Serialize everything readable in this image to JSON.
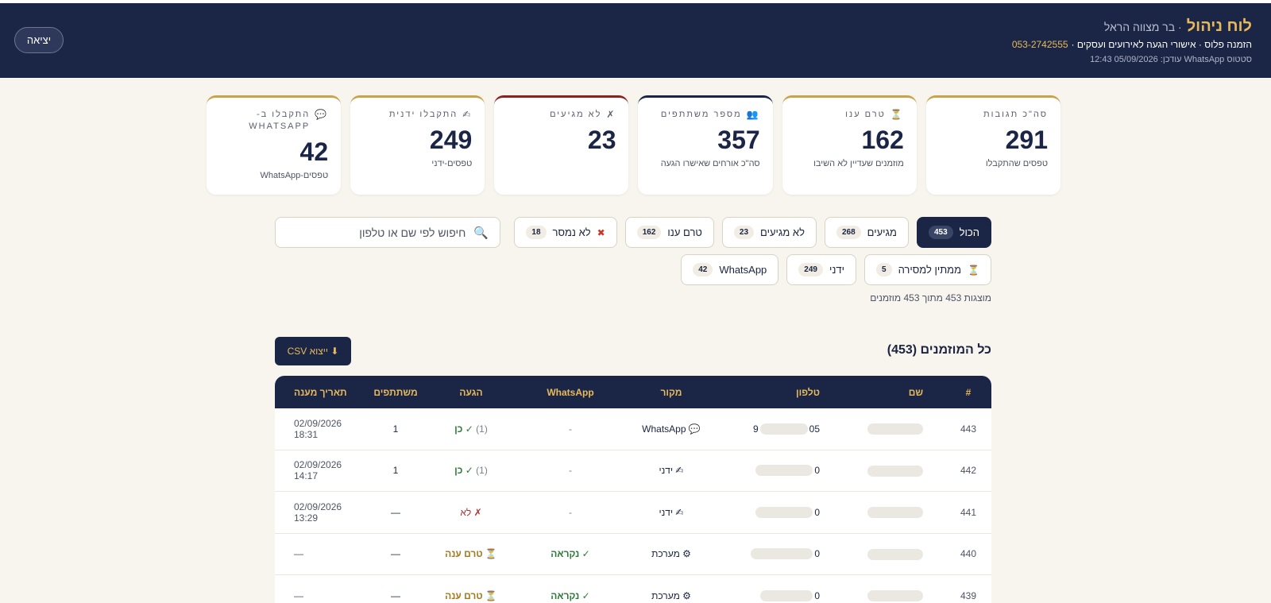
{
  "header": {
    "title": "לוח ניהול",
    "subtitle": "· בר מצווה הראל",
    "line2_text": "הזמנה פלוס · אישורי הגעה לאירועים ועסקים ·",
    "phone": "053-2742555",
    "status": "סטטוס WhatsApp עודכן: 05/09/2026 12:43",
    "logout_label": "יציאה"
  },
  "stats": [
    {
      "label": "סה\"כ תגובות",
      "icon": "",
      "value": "291",
      "desc": "טפסים שהתקבלו"
    },
    {
      "label": "טרם ענו",
      "icon": "hourglass-icon",
      "value": "162",
      "desc": "מוזמנים שעדיין לא השיבו"
    },
    {
      "label": "מספר משתתפים",
      "icon": "people-icon",
      "value": "357",
      "desc": "סה\"כ אורחים שאישרו הגעה"
    },
    {
      "label": "לא מגיעים",
      "icon": "x-icon",
      "value": "23",
      "desc": ""
    },
    {
      "label": "התקבלו ידנית",
      "icon": "hand-icon",
      "value": "249",
      "desc": "טפסים-ידני"
    },
    {
      "label": "התקבלו ב-WHATSAPP",
      "icon": "chat-icon",
      "value": "42",
      "desc": "טפסים-WhatsApp"
    }
  ],
  "filters": {
    "row1": [
      {
        "label": "הכול",
        "count": "453",
        "active": true
      },
      {
        "label": "מגיעים",
        "count": "268"
      },
      {
        "label": "לא מגיעים",
        "count": "23"
      },
      {
        "label": "טרם ענו",
        "count": "162"
      },
      {
        "label": "לא נמסר",
        "count": "18",
        "icon": "x-icon"
      }
    ],
    "row2": [
      {
        "label": "ממתין למסירה",
        "count": "5",
        "icon": "hourglass-icon"
      },
      {
        "label": "ידני",
        "count": "249"
      },
      {
        "label": "WhatsApp",
        "count": "42"
      }
    ]
  },
  "search": {
    "placeholder": "חיפוש לפי שם או טלפון"
  },
  "results_note": "מוצגות 453 מתוך 453 מוזמנים",
  "section_title": "כל המוזמנים (453)",
  "csv_label": "⬇ ייצוא CSV",
  "table": {
    "columns": [
      "#",
      "שם",
      "טלפון",
      "מקור",
      "WhatsApp",
      "הגעה",
      "משתתפים",
      "תאריך מענה"
    ],
    "rows": [
      {
        "num": "443",
        "phone": "05",
        "phone_end": "9",
        "source": "WhatsApp",
        "src_icon": "chat-icon",
        "wa": "-",
        "rsvp": "✓ כן",
        "rsvp_extra": "(1)",
        "rsvp_type": "ok",
        "part": "1",
        "date": "02/09/2026 18:31"
      },
      {
        "num": "442",
        "phone": "0",
        "phone_end": "",
        "source": "ידני",
        "src_icon": "hand-icon",
        "wa": "-",
        "rsvp": "✓ כן",
        "rsvp_extra": "(1)",
        "rsvp_type": "ok",
        "part": "1",
        "date": "02/09/2026 14:17"
      },
      {
        "num": "441",
        "phone": "0",
        "phone_end": "",
        "source": "ידני",
        "src_icon": "hand-icon",
        "wa": "-",
        "rsvp": "✗ לא",
        "rsvp_extra": "",
        "rsvp_type": "no",
        "part": "—",
        "date": "02/09/2026 13:29"
      },
      {
        "num": "440",
        "phone": "0",
        "phone_end": "",
        "source": "מערכת",
        "src_icon": "gear-icon",
        "wa": "✓ נקראה",
        "rsvp": "⏳ טרם ענה",
        "rsvp_extra": "",
        "rsvp_type": "wait",
        "part": "—",
        "date": "—"
      },
      {
        "num": "439",
        "phone": "0",
        "phone_end": "",
        "source": "מערכת",
        "src_icon": "gear-icon",
        "wa": "✓ נקראה",
        "rsvp": "⏳ טרם ענה",
        "rsvp_extra": "",
        "rsvp_type": "wait",
        "part": "—",
        "date": "—"
      }
    ]
  }
}
